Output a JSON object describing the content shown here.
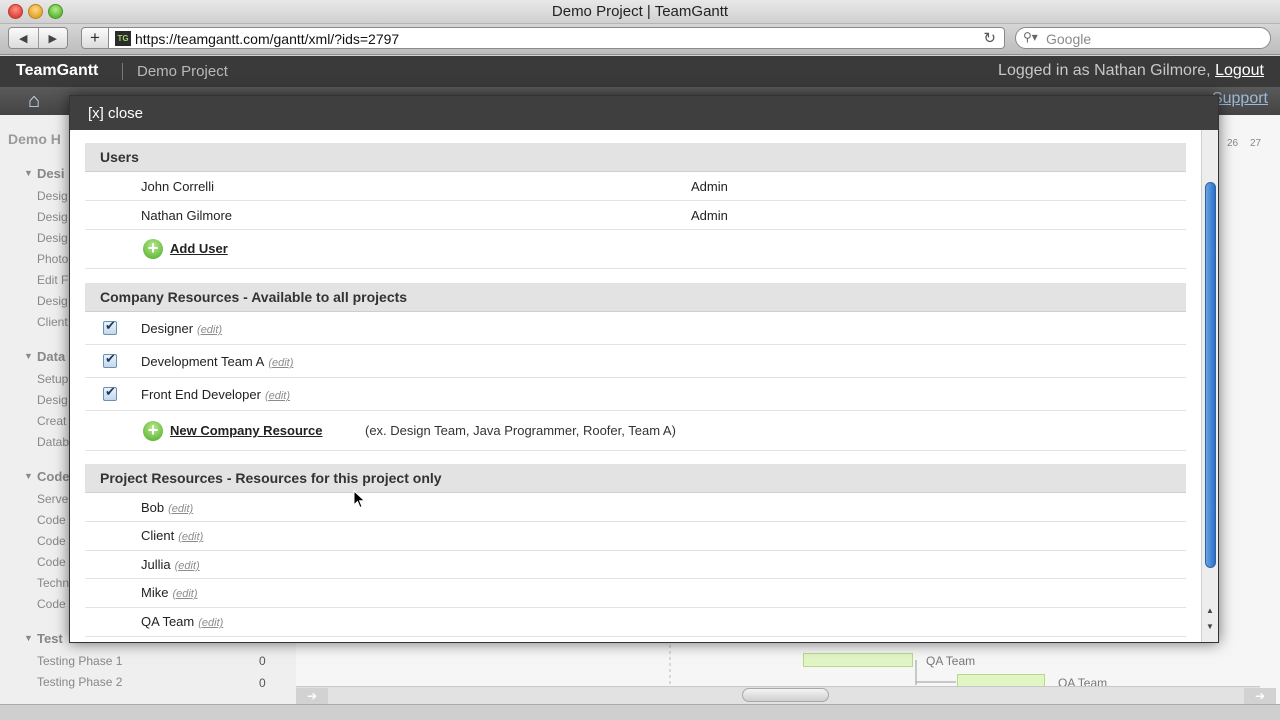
{
  "browser": {
    "window_title": "Demo Project | TeamGantt",
    "url": "https://teamgantt.com/gantt/xml/?ids=2797",
    "favicon_text": "TG",
    "search_placeholder": "Google",
    "back_icon": "◀",
    "forward_icon": "▶",
    "add_tab": "+",
    "reload_icon": "↻"
  },
  "app_header": {
    "brand": "TeamGantt",
    "project": "Demo Project",
    "login_prefix": "Logged in as Nathan Gilmore, ",
    "logout": "Logout",
    "support": "Support"
  },
  "background": {
    "title": "Demo H",
    "date_heads": [
      "26",
      "27"
    ],
    "tasks": [
      {
        "label": "Desi",
        "group": true
      },
      {
        "label": "Desig"
      },
      {
        "label": "Desig"
      },
      {
        "label": "Desig"
      },
      {
        "label": "Photo"
      },
      {
        "label": "Edit F"
      },
      {
        "label": "Desig"
      },
      {
        "label": "Client"
      },
      {
        "label": "Data",
        "group": true
      },
      {
        "label": "Setup"
      },
      {
        "label": "Desig"
      },
      {
        "label": "Creat"
      },
      {
        "label": "Datab"
      },
      {
        "label": "Code",
        "group": true
      },
      {
        "label": "Serve"
      },
      {
        "label": "Code"
      },
      {
        "label": "Code"
      },
      {
        "label": "Code"
      },
      {
        "label": "Techn"
      },
      {
        "label": "Code"
      },
      {
        "label": "Test",
        "group": true
      }
    ],
    "phase_rows": [
      {
        "label": "Testing Phase 1",
        "value": "0",
        "bar_label": "QA Team"
      },
      {
        "label": "Testing Phase 2",
        "value": "0",
        "bar_label": "QA Team"
      }
    ]
  },
  "modal": {
    "close_label": "[x] close",
    "users_header": "Users",
    "users": [
      {
        "name": "John Correlli",
        "role": "Admin"
      },
      {
        "name": "Nathan Gilmore",
        "role": "Admin"
      }
    ],
    "add_user": "Add User",
    "company_header": "Company Resources - Available to all projects",
    "company_resources": [
      {
        "name": "Designer",
        "checked": true
      },
      {
        "name": "Development Team A",
        "checked": true
      },
      {
        "name": "Front End Developer",
        "checked": true
      }
    ],
    "new_company_resource": "New Company Resource",
    "company_hint": "(ex. Design Team, Java Programmer, Roofer, Team A)",
    "project_header": "Project Resources - Resources for this project only",
    "project_resources": [
      {
        "name": "Bob"
      },
      {
        "name": "Client"
      },
      {
        "name": "Jullia"
      },
      {
        "name": "Mike"
      },
      {
        "name": "QA Team"
      }
    ],
    "edit_label": "(edit)"
  },
  "colors": {
    "header_bg": "#3a3a3a",
    "modal_header_bg": "#3f3f3f",
    "section_bg": "#e3e3e3",
    "add_green": "#66b93c",
    "scroll_blue": "#2a6fc8"
  }
}
